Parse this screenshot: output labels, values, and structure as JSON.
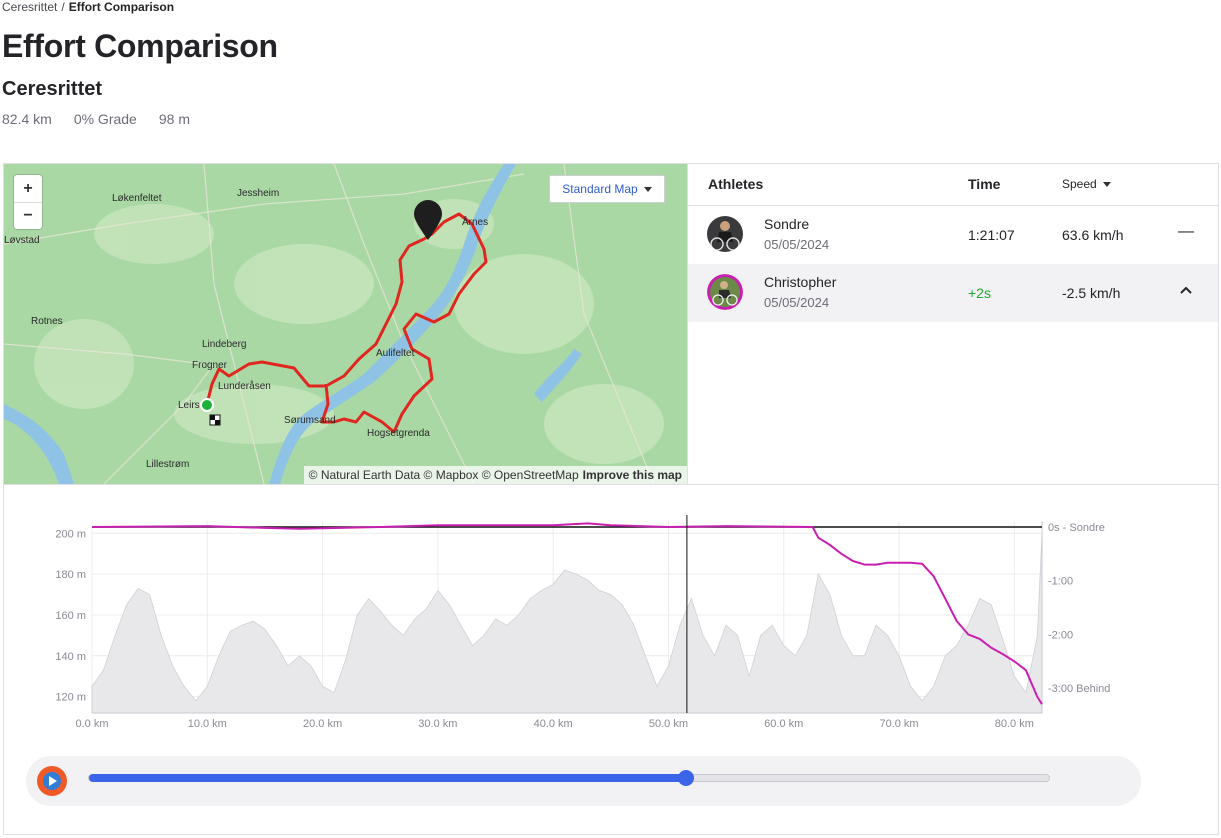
{
  "breadcrumb": {
    "parent": "Ceresrittet",
    "separator": "/",
    "current": "Effort Comparison"
  },
  "page_title": "Effort Comparison",
  "segment": {
    "name": "Ceresrittet",
    "distance": "82.4 km",
    "grade": "0% Grade",
    "elevation": "98 m"
  },
  "map": {
    "zoom_in": "+",
    "zoom_out": "−",
    "style_button": "Standard Map",
    "attribution": "© Natural Earth Data © Mapbox © OpenStreetMap",
    "improve_link": "Improve this map",
    "place_labels": [
      "Løkenfeltet",
      "Jessheim",
      "Løvstad",
      "Rotnes",
      "Lindeberg",
      "Frogner",
      "Lunderåsen",
      "Leirs",
      "Lillestrøm",
      "Årnes",
      "Aulifeltet",
      "Sørumsand",
      "Hogsetgrenda"
    ],
    "colors": {
      "land": "#a9d8a4",
      "water": "#8ec3e6",
      "route": "#e0271f",
      "start": "#1db33a"
    }
  },
  "athletes_table": {
    "col_athletes": "Athletes",
    "col_time": "Time",
    "col_speed": "Speed",
    "rows": [
      {
        "name": "Sondre",
        "date": "05/05/2024",
        "time": "1:21:07",
        "speed": "63.6 km/h",
        "action": "—",
        "avatar": "cyclist-avatar-dark"
      },
      {
        "name": "Christopher",
        "date": "05/05/2024",
        "time": "+2s",
        "speed": "-2.5 km/h",
        "action": "^",
        "avatar": "cyclist-avatar-magenta-ring"
      }
    ]
  },
  "chart_data": {
    "type": "area",
    "x_axis": {
      "ticks": [
        "0.0 km",
        "10.0 km",
        "20.0 km",
        "30.0 km",
        "40.0 km",
        "50.0 km",
        "60.0 km",
        "70.0 km",
        "80.0 km"
      ],
      "range": [
        0,
        82.4
      ]
    },
    "y_left": {
      "ticks": [
        "200 m",
        "180 m",
        "160 m",
        "140 m",
        "120 m"
      ],
      "range": [
        112,
        206
      ]
    },
    "y_right": {
      "ticks": [
        "0s - Sondre",
        "-1:00",
        "-2:00",
        "-3:00 Behind"
      ],
      "range_seconds": [
        0,
        -200
      ]
    },
    "cursor_km": 51.6,
    "series": [
      {
        "name": "Elevation",
        "kind": "area",
        "color": "#e8e8ea",
        "x": [
          0,
          1,
          2,
          3,
          4,
          5,
          6,
          7,
          8,
          9,
          10,
          11,
          12,
          13,
          14,
          15,
          16,
          17,
          18,
          19,
          20,
          21,
          22,
          23,
          24,
          25,
          26,
          27,
          28,
          29,
          30,
          31,
          32,
          33,
          34,
          35,
          36,
          37,
          38,
          39,
          40,
          41,
          42,
          43,
          44,
          45,
          46,
          47,
          48,
          49,
          50,
          51,
          52,
          53,
          54,
          55,
          56,
          57,
          58,
          59,
          60,
          61,
          62,
          63,
          64,
          65,
          66,
          67,
          68,
          69,
          70,
          71,
          72,
          73,
          74,
          75,
          76,
          77,
          78,
          79,
          80,
          81,
          82,
          82.4
        ],
        "y": [
          125,
          133,
          150,
          165,
          173,
          170,
          150,
          135,
          125,
          118,
          125,
          140,
          152,
          155,
          157,
          153,
          145,
          135,
          140,
          135,
          125,
          122,
          138,
          160,
          168,
          162,
          155,
          150,
          158,
          163,
          172,
          165,
          155,
          145,
          150,
          158,
          155,
          160,
          168,
          172,
          175,
          182,
          180,
          177,
          172,
          170,
          165,
          155,
          140,
          125,
          135,
          155,
          168,
          150,
          140,
          155,
          150,
          130,
          150,
          155,
          145,
          140,
          150,
          180,
          170,
          150,
          140,
          140,
          155,
          150,
          140,
          125,
          118,
          125,
          140,
          145,
          155,
          168,
          165,
          148,
          130,
          122,
          150,
          200
        ]
      },
      {
        "name": "Sondre",
        "kind": "line",
        "color": "#111111",
        "x": [
          0,
          82.4
        ],
        "y": [
          0,
          0
        ]
      },
      {
        "name": "Christopher",
        "kind": "line",
        "color": "#c91fb0",
        "x": [
          0,
          10,
          15,
          18,
          25,
          30,
          40,
          43,
          45,
          50,
          55,
          62.5,
          63,
          64,
          65,
          66,
          67,
          68,
          69,
          70,
          71,
          72,
          73,
          74,
          75,
          76,
          77,
          78,
          79,
          80,
          81,
          82,
          82.4
        ],
        "y": [
          0,
          1,
          -1,
          -2,
          0,
          2,
          2,
          4,
          2,
          0,
          1,
          0,
          -12,
          -20,
          -30,
          -38,
          -42,
          -42,
          -40,
          -40,
          -40,
          -41,
          -55,
          -80,
          -105,
          -120,
          -125,
          -135,
          -142,
          -150,
          -160,
          -190,
          -198
        ]
      }
    ]
  },
  "playback": {
    "progress": 0.622,
    "play_icon": "play-icon"
  }
}
